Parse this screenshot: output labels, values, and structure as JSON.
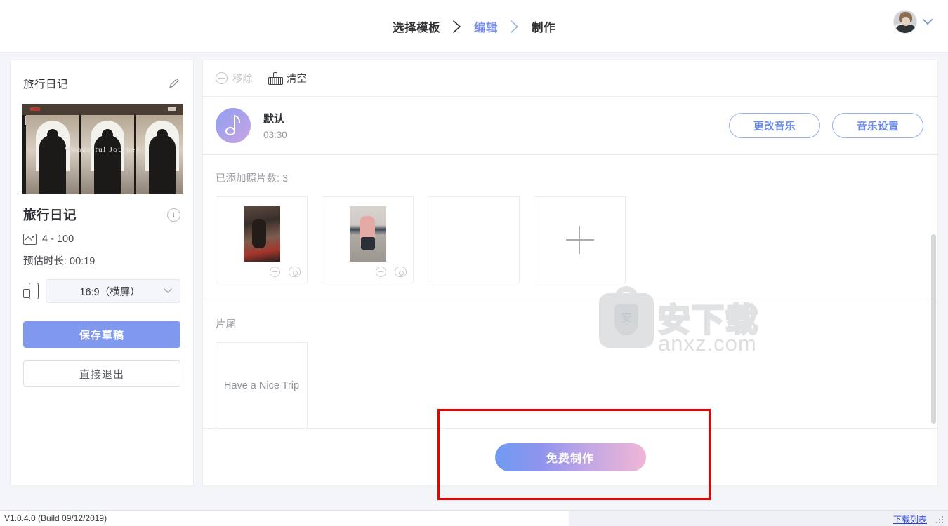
{
  "header": {
    "steps": [
      {
        "label": "选择模板",
        "active": false
      },
      {
        "label": "编辑",
        "active": true
      },
      {
        "label": "制作",
        "active": false
      }
    ],
    "chevron": "›",
    "avatar_alt": "user-avatar",
    "caret": "⌄"
  },
  "sidebar": {
    "project_title": "旅行日记",
    "edit_icon": "pencil-icon",
    "thumbnail_caption": "Wonderful Journey",
    "template_name": "旅行日记",
    "info_icon": "i",
    "photo_range": "4 - 100",
    "duration": "预估时长: 00:19",
    "ratio_value": "16:9（横屏）",
    "ratio_caret": "⌄",
    "save_draft": "保存草稿",
    "exit_direct": "直接退出"
  },
  "toolbar": {
    "remove": "移除",
    "clear": "清空"
  },
  "music": {
    "name": "默认",
    "time": "03:30",
    "change_music": "更改音乐",
    "music_settings": "音乐设置"
  },
  "photos": {
    "count_label": "已添加照片数: 3",
    "cards": [
      {
        "type": "photo",
        "has_actions": true
      },
      {
        "type": "photo",
        "has_actions": true
      },
      {
        "type": "empty",
        "has_actions": false
      },
      {
        "type": "add",
        "has_actions": false
      }
    ],
    "minus_icon": "minus-circle-icon",
    "eye_icon": "eye-icon",
    "add_icon": "plus-icon"
  },
  "tail": {
    "section_label": "片尾",
    "card_text": "Have a Nice Trip"
  },
  "bottom": {
    "make_button": "免费制作"
  },
  "footer": {
    "version": "V1.0.4.0 (Build 09/12/2019)",
    "download_list": "下载列表"
  },
  "watermark": {
    "zh": "安下载",
    "en": "anxz.com",
    "shield_char": "安"
  },
  "colors": {
    "accent_blue": "#7b8fe8",
    "primary_button": "#8099ee",
    "outline_button_border": "#9ab0ee",
    "outline_button_text": "#6a8ae6",
    "highlight_red": "#ee0000",
    "link_blue": "#2a41d6",
    "page_bg": "#f4f5f8"
  }
}
